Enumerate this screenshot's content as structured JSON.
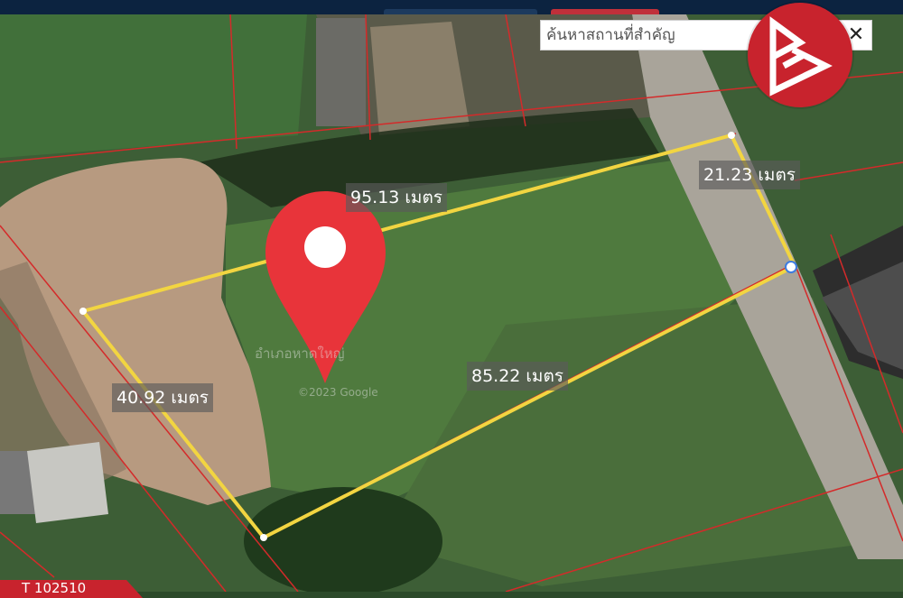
{
  "search": {
    "placeholder": "ค้นหาสถานที่สำคัญ",
    "close_label": "✕"
  },
  "measurements": {
    "top_side": "95.13 เมตร",
    "right_side": "21.23 เมตร",
    "bottom_side": "85.22 เมตร",
    "left_side": "40.92 เมตร"
  },
  "map_overlay": {
    "place_label": "อำเภอหาดใหญ่",
    "copyright": "©2023 Google"
  },
  "badge": {
    "label": "T 102510"
  },
  "colors": {
    "boundary": "#f2d541",
    "parcel_lines": "#d42a2a",
    "pin": "#e8343a",
    "brand": "#c8232d"
  },
  "icons": {
    "pin": "map-pin-icon",
    "logo": "brand-logo-icon",
    "close": "close-icon"
  }
}
